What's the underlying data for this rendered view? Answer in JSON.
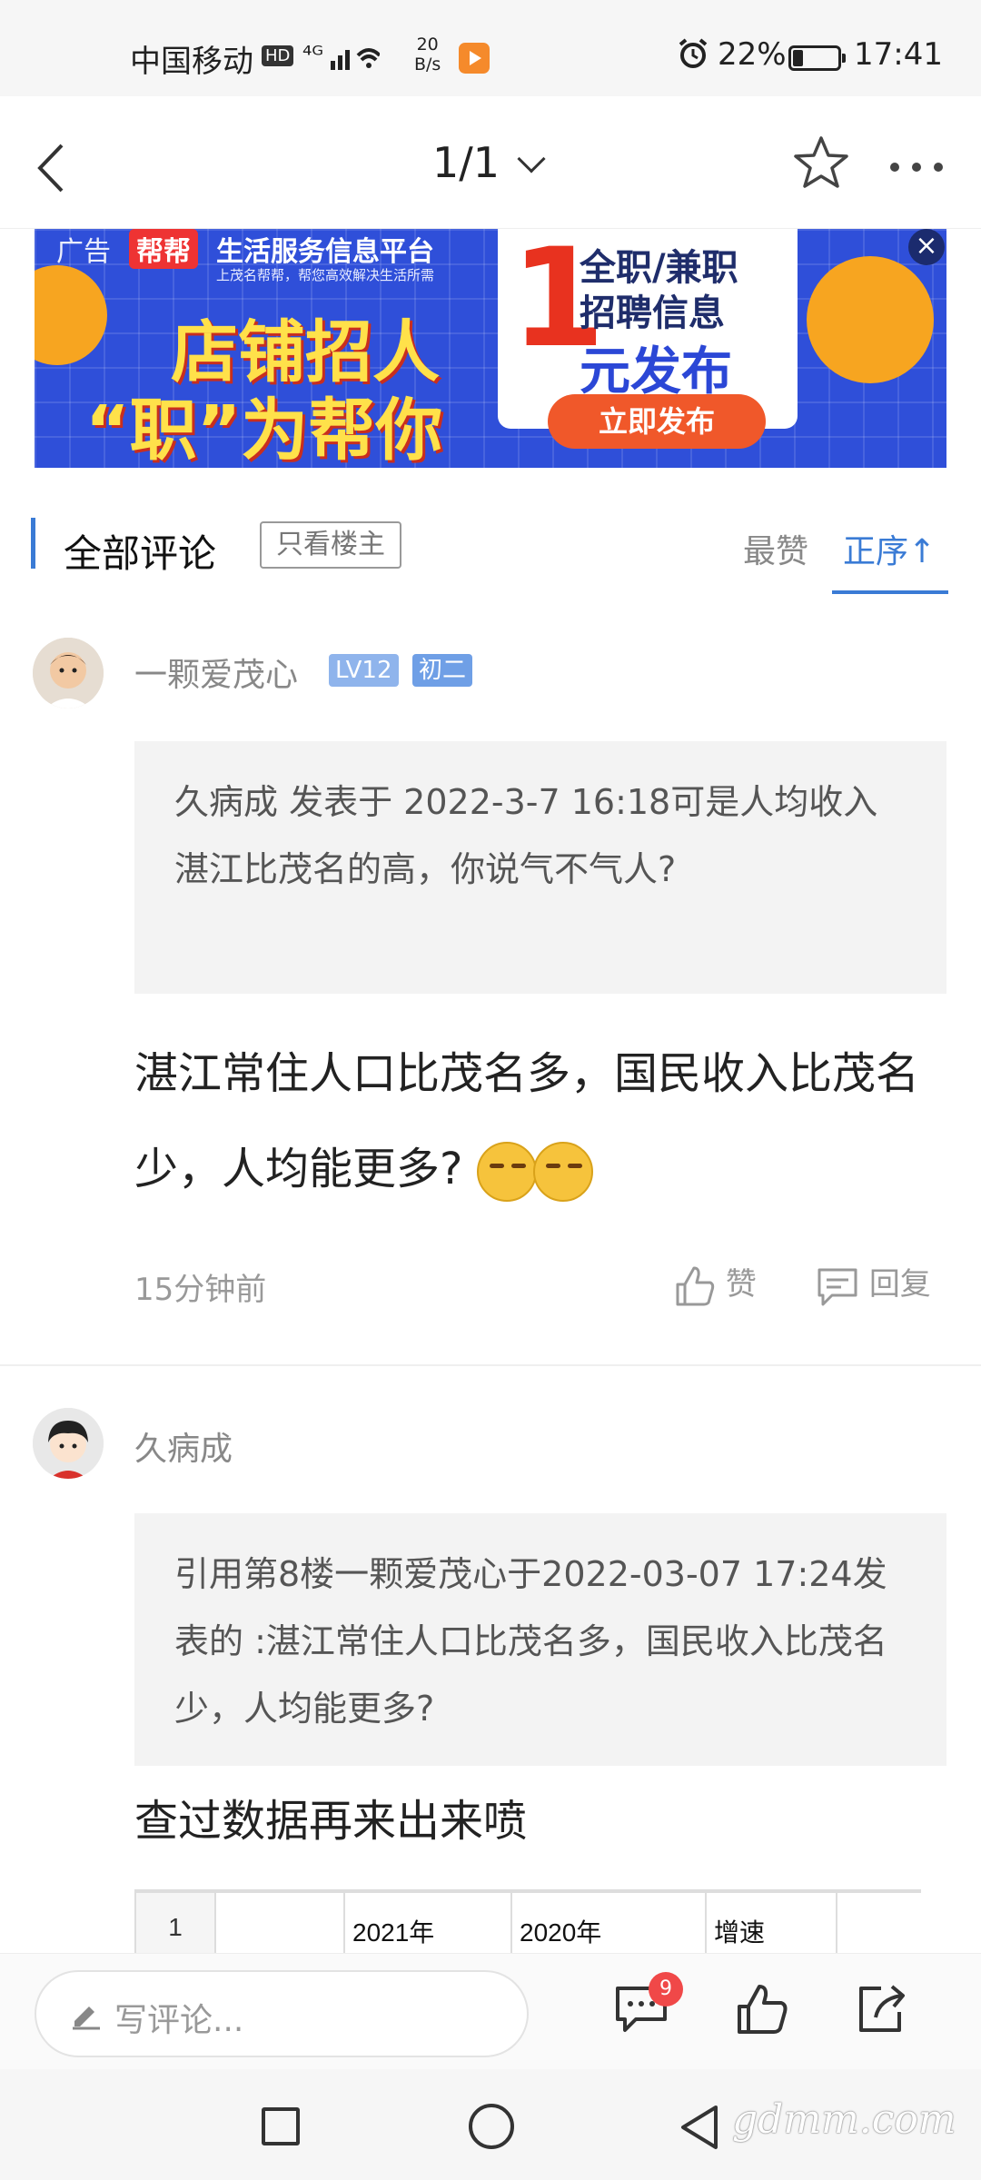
{
  "status_bar": {
    "carrier": "中国移动",
    "hd": "HD",
    "network": "⁴ᴳ",
    "speed_value": "20",
    "speed_unit": "B/s",
    "battery": "22%",
    "time": "17:41"
  },
  "nav": {
    "page_indicator": "1/1"
  },
  "ad": {
    "tag": "广告",
    "brand": "帮帮",
    "platform": "生活服务信息平台",
    "subtitle": "上茂名帮帮，帮您高效解决生活所需",
    "headline_1": "店铺招人",
    "headline_2": "“职”为帮你",
    "big_number": "1",
    "card_line_1": "全职/兼职",
    "card_line_2": "招聘信息",
    "card_line_3": "元发布",
    "cta": "立即发布",
    "close": "×"
  },
  "comment_header": {
    "title": "全部评论",
    "op_only": "只看楼主",
    "sort_hot": "最赞",
    "sort_seq": "正序↑"
  },
  "comments": [
    {
      "user": "一颗爱茂心",
      "level": "LV12",
      "rank": "初二",
      "quote": "久病成 发表于 2022-3-7 16:18可是人均收入湛江比茂名的高，你说气不气人?",
      "body": "湛江常住人口比茂名多，国民收入比茂名少，人均能更多?",
      "time": "15分钟前",
      "like_label": "赞",
      "reply_label": "回复"
    },
    {
      "user": "久病成",
      "quote": "引用第8楼一颗爱茂心于2022-03-07 17:24发表的 :湛江常住人口比茂名多，国民收入比茂名少，人均能更多?",
      "body": "查过数据再来出来喷",
      "sheet": {
        "row_number": "1",
        "col_b": "",
        "col_c": "2021年",
        "col_d": "2020年",
        "col_e": "增速"
      }
    }
  ],
  "comment_bar": {
    "placeholder": "写评论...",
    "comment_count": "9"
  },
  "watermark": "gdmm.com",
  "colors": {
    "accent": "#3a7bd5",
    "badge_level": "#8fb4ec",
    "badge_rank": "#6f9fe6",
    "ad_blue": "#2f4fd9",
    "ad_red": "#e8321f",
    "notify_red": "#f04848"
  }
}
